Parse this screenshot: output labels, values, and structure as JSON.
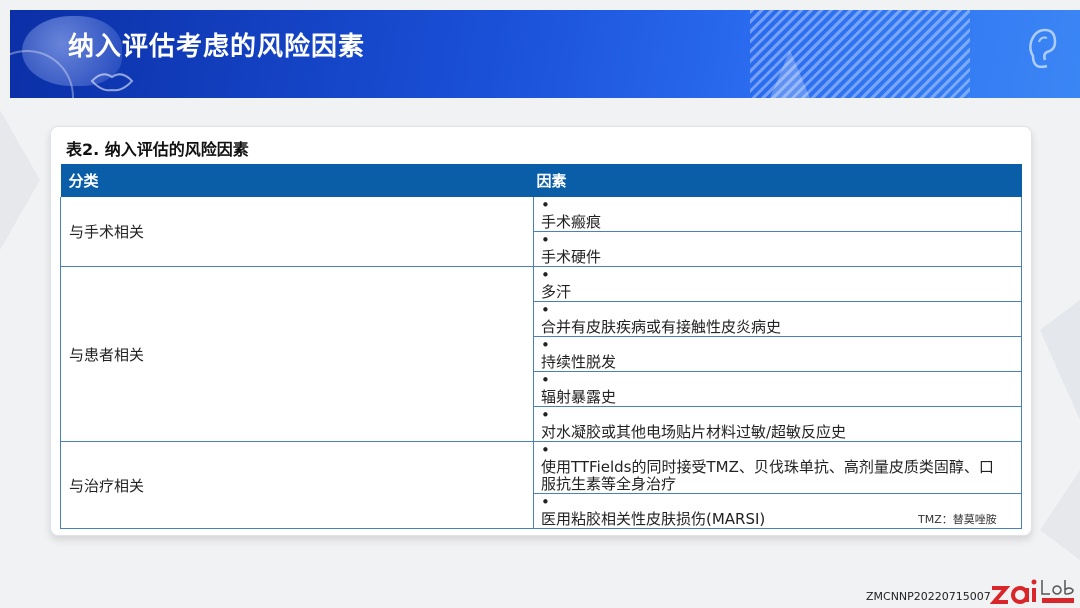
{
  "header": {
    "title": "纳入评估考虑的风险因素"
  },
  "table": {
    "caption": "表2. 纳入评估的风险因素",
    "columns": [
      "分类",
      "因素"
    ],
    "groups": [
      {
        "category": "与手术相关",
        "factors": [
          "手术瘢痕",
          "手术硬件"
        ]
      },
      {
        "category": "与患者相关",
        "factors": [
          "多汗",
          "合并有皮肤疾病或有接触性皮炎病史",
          "持续性脱发",
          "辐射暴露史",
          "对水凝胶或其他电场贴片材料过敏/超敏反应史"
        ]
      },
      {
        "category": "与治疗相关",
        "factors": [
          "使用TTFields的同时接受TMZ、贝伐珠单抗、高剂量皮质类固醇、口服抗生素等全身治疗",
          "医用粘胶相关性皮肤损伤(MARSI)"
        ]
      }
    ],
    "bullet": "•",
    "note": "TMZ：替莫唑胺"
  },
  "footer": {
    "code": "ZMCNNP20220715007"
  },
  "colors": {
    "header_dark": "#0b2fa6",
    "header_light": "#3b86f5",
    "table_header": "#0a5ea8",
    "logo_red": "#d9262b"
  },
  "icons": [
    "brain-icon",
    "ear-icon",
    "lips-icon"
  ]
}
